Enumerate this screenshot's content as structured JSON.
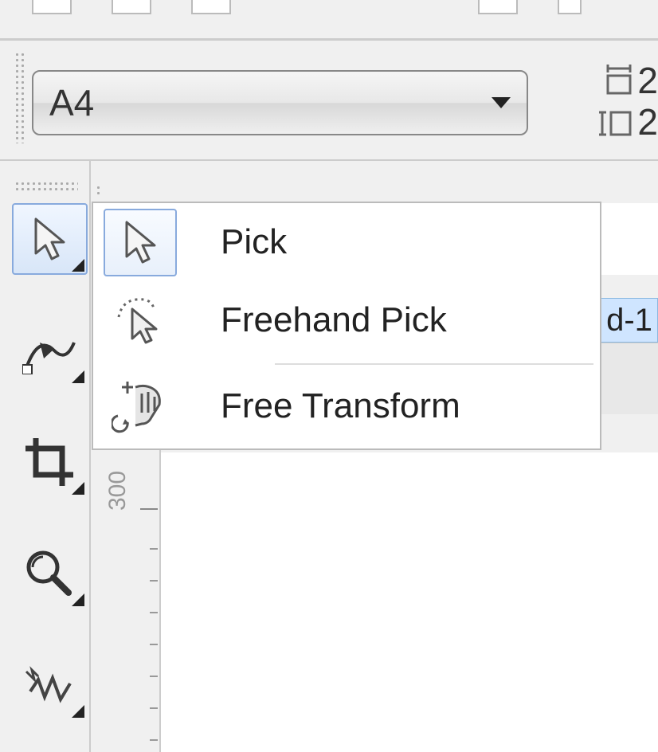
{
  "page_dropdown": {
    "selected": "A4"
  },
  "dimensions": {
    "width_partial": "2",
    "height_partial": "2"
  },
  "toolbox": {
    "tools": [
      {
        "name": "pick",
        "selected": true
      },
      {
        "name": "shape-edit"
      },
      {
        "name": "crop"
      },
      {
        "name": "zoom"
      },
      {
        "name": "freehand-draw"
      }
    ]
  },
  "flyout_menu": {
    "items": [
      {
        "label": "Pick",
        "selected": true
      },
      {
        "label": "Freehand Pick",
        "selected": false
      },
      {
        "label": "Free Transform",
        "selected": false
      }
    ]
  },
  "ruler": {
    "label": "300"
  },
  "tab": {
    "partial_text": "d-1"
  }
}
